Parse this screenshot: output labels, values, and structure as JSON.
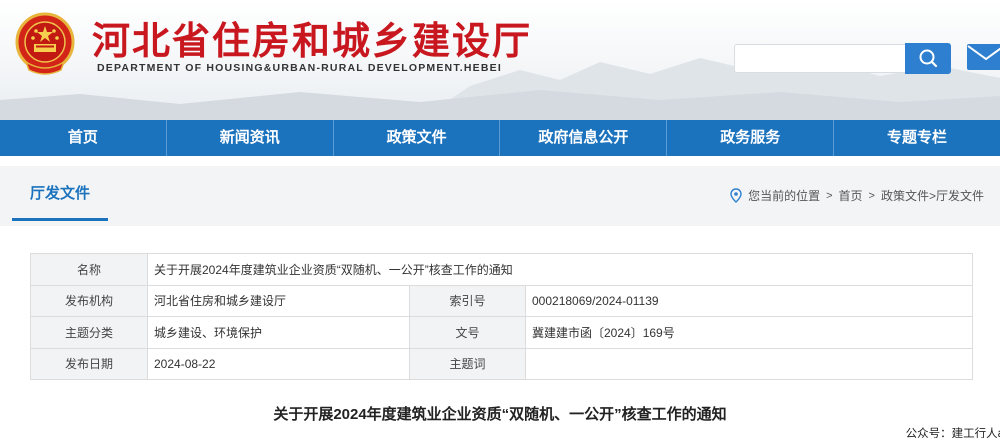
{
  "header": {
    "title": "河北省住房和城乡建设厅",
    "subtitle": "DEPARTMENT OF HOUSING&URBAN-RURAL DEVELOPMENT.HEBEI",
    "search_placeholder": "",
    "search_icon": "search-icon",
    "mail_icon": "mail-icon"
  },
  "nav": {
    "items": [
      "首页",
      "新闻资讯",
      "政策文件",
      "政府信息公开",
      "政务服务",
      "专题专栏"
    ]
  },
  "section": {
    "title": "厅发文件"
  },
  "breadcrumb": {
    "prefix": "您当前的位置",
    "items": [
      "首页",
      "政策文件>厅发文件"
    ]
  },
  "meta": {
    "name_label": "名称",
    "name_value": "关于开展2024年度建筑业企业资质“双随机、一公开”核查工作的通知",
    "issuer_label": "发布机构",
    "issuer_value": "河北省住房和城乡建设厅",
    "index_label": "索引号",
    "index_value": "000218069/2024-01139",
    "category_label": "主题分类",
    "category_value": "城乡建设、环境保护",
    "docno_label": "文号",
    "docno_value": "冀建建市函〔2024〕169号",
    "date_label": "发布日期",
    "date_value": "2024-08-22",
    "keyword_label": "主题词",
    "keyword_value": ""
  },
  "document": {
    "title": "关于开展2024年度建筑业企业资质“双随机、一公开”核查工作的通知"
  },
  "watermark": "公众号：建工行人a",
  "colors": {
    "brand_red": "#c8171e",
    "nav_blue": "#1b72bd",
    "search_blue": "#2f7fd0"
  }
}
